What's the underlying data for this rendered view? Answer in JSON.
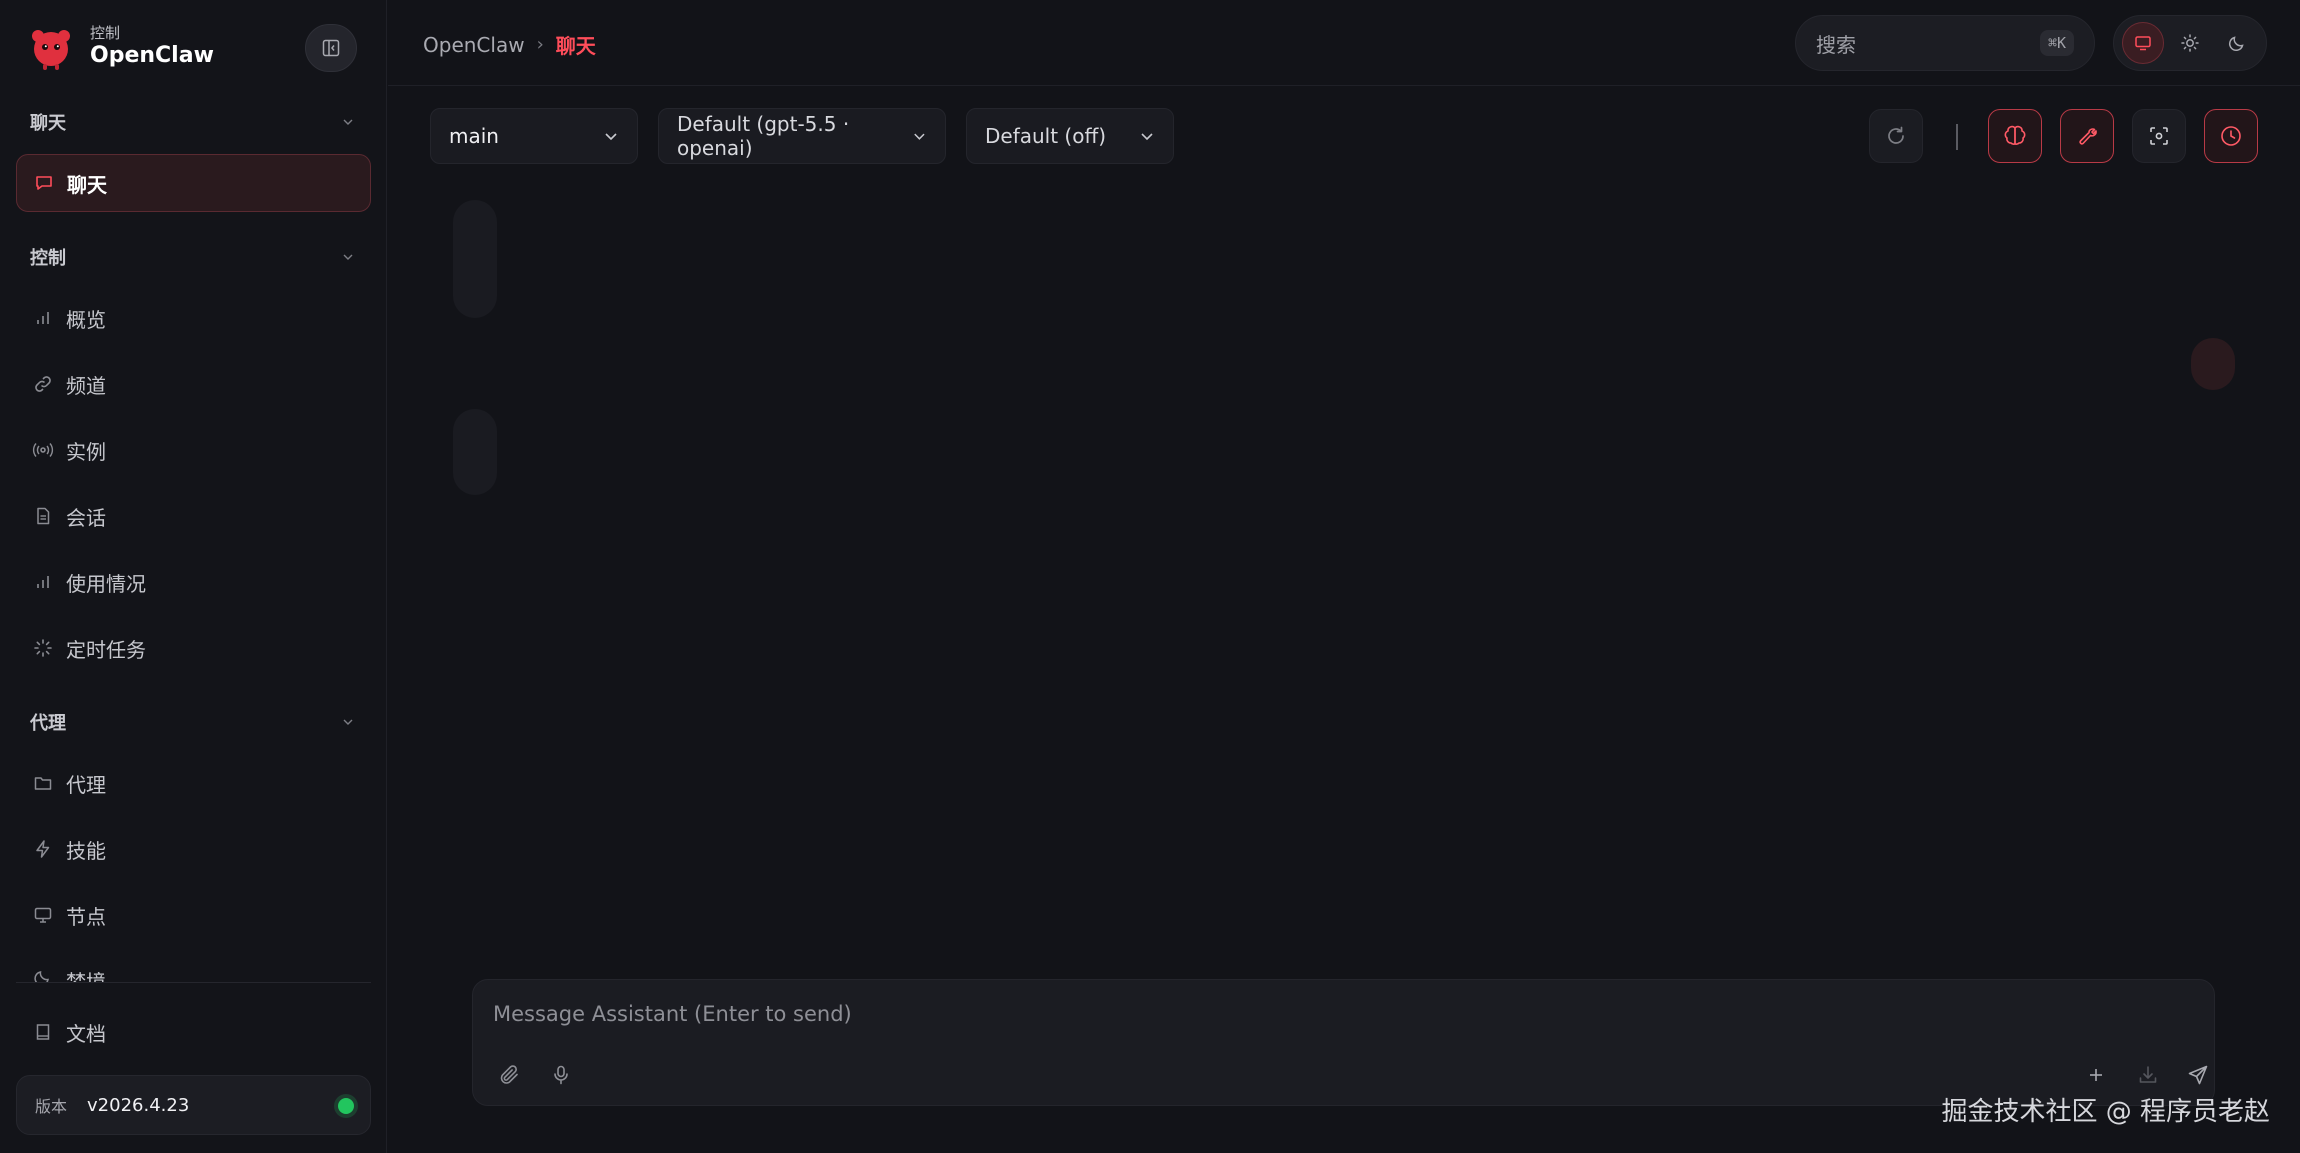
{
  "sidebar": {
    "brand": {
      "subtitle": "控制",
      "name": "OpenClaw"
    },
    "sections": [
      {
        "label": "聊天",
        "items": [
          {
            "label": "聊天",
            "icon": "message-square-icon",
            "active": true
          }
        ]
      },
      {
        "label": "控制",
        "items": [
          {
            "label": "概览",
            "icon": "bar-chart-icon"
          },
          {
            "label": "频道",
            "icon": "link-icon"
          },
          {
            "label": "实例",
            "icon": "radio-icon"
          },
          {
            "label": "会话",
            "icon": "file-text-icon"
          },
          {
            "label": "使用情况",
            "icon": "bar-chart-icon"
          },
          {
            "label": "定时任务",
            "icon": "loader-icon"
          }
        ]
      },
      {
        "label": "代理",
        "items": [
          {
            "label": "代理",
            "icon": "folder-icon"
          },
          {
            "label": "技能",
            "icon": "zap-icon"
          },
          {
            "label": "节点",
            "icon": "monitor-icon"
          },
          {
            "label": "梦境",
            "icon": "moon-icon"
          }
        ]
      }
    ],
    "docs": {
      "label": "文档",
      "icon": "book-icon"
    },
    "version": {
      "label": "版本",
      "value": "v2026.4.23",
      "status_color": "#22c55e"
    }
  },
  "topbar": {
    "breadcrumb": {
      "root": "OpenClaw",
      "separator": "›",
      "current": "聊天"
    },
    "search": {
      "placeholder": "搜索",
      "shortcut": "⌘K"
    },
    "theme": {
      "options": [
        "monitor-icon",
        "sun-icon",
        "moon-icon"
      ],
      "active": "monitor-icon"
    }
  },
  "toolbar": {
    "session": "main",
    "model": "Default (gpt-5.5 · openai)",
    "thinking": "Default (off)",
    "actions": [
      "refresh-icon",
      "brain-icon",
      "wrench-icon",
      "focus-icon",
      "clock-icon"
    ]
  },
  "composer": {
    "placeholder": "Message Assistant (Enter to send)",
    "icons": [
      "paperclip-icon",
      "mic-icon",
      "plus-icon",
      "download-icon",
      "send-icon"
    ]
  },
  "watermark": "掘金技术社区 @ 程序员老赵",
  "colors": {
    "accent": "#ff4d5a",
    "background": "#121318",
    "sidebar": "#131419",
    "status": "#22c55e"
  }
}
